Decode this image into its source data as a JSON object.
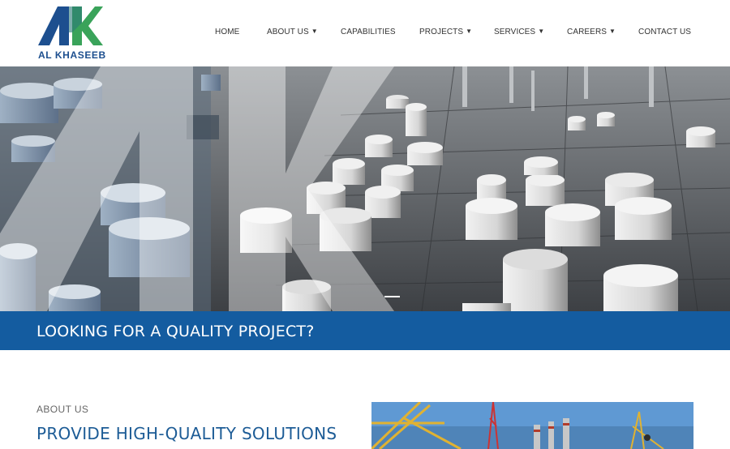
{
  "brand": {
    "name": "AL KHASEEB",
    "logo_icon": "ak-logo",
    "colors": {
      "navy": "#1d4f8f",
      "green": "#3aa35a",
      "banner": "#145ca0",
      "heading": "#1d5c96"
    }
  },
  "nav": {
    "items": [
      {
        "label": "HOME",
        "dropdown": false
      },
      {
        "label": "ABOUT US",
        "dropdown": true
      },
      {
        "label": "CAPABILITIES",
        "dropdown": false
      },
      {
        "label": "PROJECTS",
        "dropdown": true
      },
      {
        "label": "SERVICES",
        "dropdown": true
      },
      {
        "label": "CAREERS",
        "dropdown": true
      },
      {
        "label": "CONTACT US",
        "dropdown": false
      }
    ],
    "caret_glyph": "▼"
  },
  "hero": {
    "image": "refinery-storage-tanks-photo",
    "slider_active_index": 1
  },
  "banner": {
    "text": "LOOKING FOR A QUALITY PROJECT?"
  },
  "about": {
    "label": "ABOUT US",
    "heading": "PROVIDE HIGH-QUALITY SOLUTIONS",
    "image": "industrial-structure-photo"
  }
}
